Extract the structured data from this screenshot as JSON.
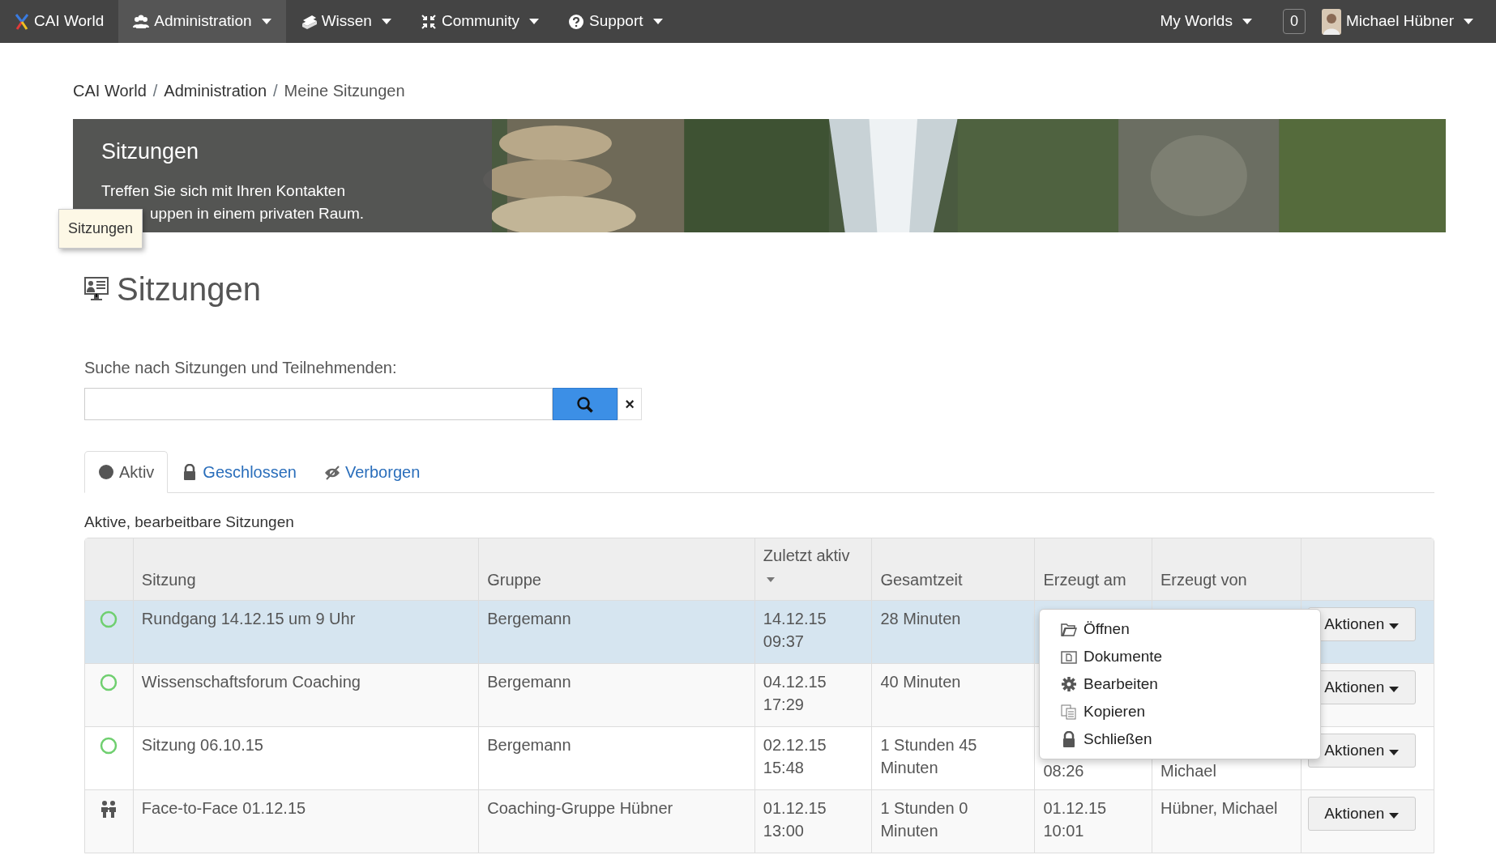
{
  "navbar": {
    "brand": "CAI World",
    "items": [
      {
        "label": "Administration",
        "selected": true
      },
      {
        "label": "Wissen",
        "selected": false
      },
      {
        "label": "Community",
        "selected": false
      },
      {
        "label": "Support",
        "selected": false
      }
    ],
    "worlds": "My Worlds",
    "count": "0",
    "user": "Michael Hübner"
  },
  "breadcrumb": [
    {
      "kind": "link",
      "text": "CAI World"
    },
    {
      "kind": "separator",
      "text": "/"
    },
    {
      "kind": "link",
      "text": "Administration"
    },
    {
      "kind": "separator",
      "text": "/"
    },
    {
      "kind": "current",
      "text": "Meine Sitzungen"
    }
  ],
  "banner": {
    "title": "Sitzungen",
    "text_line_1": "Treffen Sie sich mit Ihren Kontakten",
    "text_line_2": "uppen in einem privaten Raum.",
    "tooltip": "Sitzungen"
  },
  "heading": "Sitzungen",
  "search": {
    "label": "Suche nach Sitzungen und Teilnehmenden:",
    "clear": "×"
  },
  "tabs": [
    {
      "label": "Aktiv",
      "selected": true
    },
    {
      "label": "Geschlossen",
      "selected": false
    },
    {
      "label": "Verborgen",
      "selected": false
    }
  ],
  "table": {
    "caption": "Aktive, bearbeitbare Sitzungen",
    "columns": [
      "Sitzung",
      "Gruppe",
      "Zuletzt aktiv",
      "Gesamtzeit",
      "Erzeugt am",
      "Erzeugt von"
    ],
    "rows": [
      {
        "kind": "online",
        "selected": true,
        "cells": [
          "Rundgang 14.12.15 um 9 Uhr",
          "Bergemann",
          "14.12.15 09:37",
          "28 Minuten",
          "",
          ""
        ],
        "action": "Aktionen"
      },
      {
        "kind": "online",
        "selected": false,
        "cells": [
          "Wissenschaftsforum Coaching",
          "Bergemann",
          "04.12.15 17:29",
          "40 Minuten",
          "",
          ""
        ],
        "action": "Aktionen"
      },
      {
        "kind": "online",
        "selected": false,
        "cells": [
          "Sitzung 06.10.15",
          "Bergemann",
          "02.12.15 15:48",
          "1 Stunden 45 Minuten",
          "08:26",
          "Michael"
        ],
        "action": "Aktionen"
      },
      {
        "kind": "face",
        "selected": false,
        "cells": [
          "Face-to-Face 01.12.15",
          "Coaching-Gruppe Hübner",
          "01.12.15 13:00",
          "1 Stunden 0 Minuten",
          "01.12.15 10:01",
          "Hübner, Michael"
        ],
        "action": "Aktionen"
      }
    ]
  },
  "menu": [
    "Öffnen",
    "Dokumente",
    "Bearbeiten",
    "Kopieren",
    "Schließen"
  ]
}
